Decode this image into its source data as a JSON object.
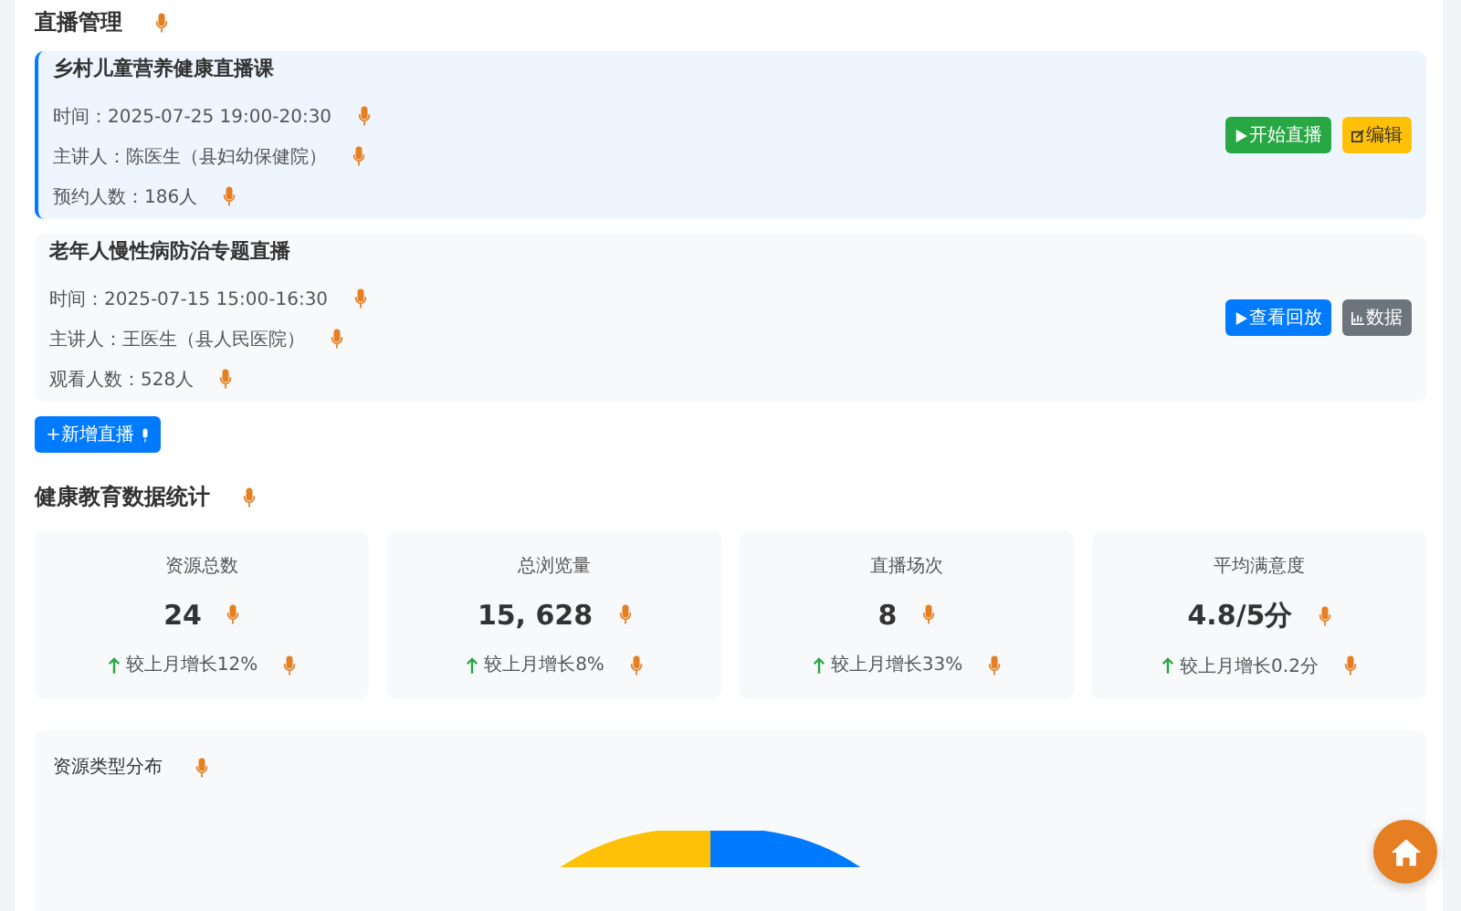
{
  "live_section": {
    "title": "直播管理"
  },
  "lives": [
    {
      "title": "乡村儿童营养健康直播课",
      "highlighted": true,
      "lines": [
        "时间：2025-07-25 19:00-20:30",
        "主讲人：陈医生（县妇幼保健院）",
        "预约人数：186人"
      ],
      "buttons": [
        {
          "label": "开始直播",
          "kind": "start"
        },
        {
          "label": "编辑",
          "kind": "edit"
        }
      ]
    },
    {
      "title": "老年人慢性病防治专题直播",
      "highlighted": false,
      "lines": [
        "时间：2025-07-15 15:00-16:30",
        "主讲人：王医生（县人民医院）",
        "观看人数：528人"
      ],
      "buttons": [
        {
          "label": "查看回放",
          "kind": "replay"
        },
        {
          "label": "数据",
          "kind": "stats"
        }
      ]
    }
  ],
  "add_button": {
    "label": "+新增直播"
  },
  "stats_section": {
    "title": "健康教育数据统计"
  },
  "stats": [
    {
      "label": "资源总数",
      "value": "24",
      "trend": "较上月增长12%"
    },
    {
      "label": "总浏览量",
      "value": "15, 628",
      "trend": "较上月增长8%"
    },
    {
      "label": "直播场次",
      "value": "8",
      "trend": "较上月增长33%"
    },
    {
      "label": "平均满意度",
      "value": "4.8/5分",
      "trend": "较上月增长0.2分"
    }
  ],
  "chart_panel": {
    "title": "资源类型分布"
  }
}
